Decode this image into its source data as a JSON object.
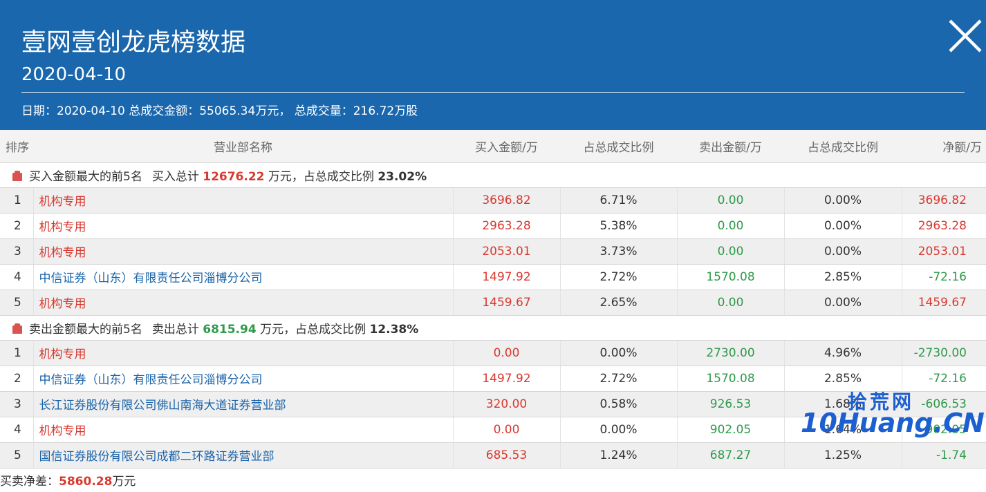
{
  "header": {
    "title": "壹网壹创龙虎榜数据",
    "date": "2020-04-10",
    "summary": "日期：2020-04-10 总成交金额：55065.34万元， 总成交量：216.72万股"
  },
  "table": {
    "columns": [
      "排序",
      "营业部名称",
      "买入金额/万",
      "占总成交比例",
      "卖出金额/万",
      "占总成交比例",
      "净额/万"
    ],
    "buy_group": {
      "label": "买入金额最大的前5名",
      "total_prefix": "买入总计",
      "total_value": "12676.22",
      "total_unit": "万元，",
      "ratio_prefix": "占总成交比例",
      "ratio_value": "23.02%"
    },
    "buy_rows": [
      {
        "rank": "1",
        "name": "机构专用",
        "buy": "3696.82",
        "buy_pct": "6.71%",
        "sell": "0.00",
        "sell_pct": "0.00%",
        "net": "3696.82"
      },
      {
        "rank": "2",
        "name": "机构专用",
        "buy": "2963.28",
        "buy_pct": "5.38%",
        "sell": "0.00",
        "sell_pct": "0.00%",
        "net": "2963.28"
      },
      {
        "rank": "3",
        "name": "机构专用",
        "buy": "2053.01",
        "buy_pct": "3.73%",
        "sell": "0.00",
        "sell_pct": "0.00%",
        "net": "2053.01"
      },
      {
        "rank": "4",
        "name": "中信证券（山东）有限责任公司淄博分公司",
        "buy": "1497.92",
        "buy_pct": "2.72%",
        "sell": "1570.08",
        "sell_pct": "2.85%",
        "net": "-72.16"
      },
      {
        "rank": "5",
        "name": "机构专用",
        "buy": "1459.67",
        "buy_pct": "2.65%",
        "sell": "0.00",
        "sell_pct": "0.00%",
        "net": "1459.67"
      }
    ],
    "sell_group": {
      "label": "卖出金额最大的前5名",
      "total_prefix": "卖出总计",
      "total_value": "6815.94",
      "total_unit": "万元，",
      "ratio_prefix": "占总成交比例",
      "ratio_value": "12.38%"
    },
    "sell_rows": [
      {
        "rank": "1",
        "name": "机构专用",
        "buy": "0.00",
        "buy_pct": "0.00%",
        "sell": "2730.00",
        "sell_pct": "4.96%",
        "net": "-2730.00"
      },
      {
        "rank": "2",
        "name": "中信证券（山东）有限责任公司淄博分公司",
        "buy": "1497.92",
        "buy_pct": "2.72%",
        "sell": "1570.08",
        "sell_pct": "2.85%",
        "net": "-72.16"
      },
      {
        "rank": "3",
        "name": "长江证券股份有限公司佛山南海大道证券营业部",
        "buy": "320.00",
        "buy_pct": "0.58%",
        "sell": "926.53",
        "sell_pct": "1.68%",
        "net": "-606.53"
      },
      {
        "rank": "4",
        "name": "机构专用",
        "buy": "0.00",
        "buy_pct": "0.00%",
        "sell": "902.05",
        "sell_pct": "1.64%",
        "net": "-902.05"
      },
      {
        "rank": "5",
        "name": "国信证券股份有限公司成都二环路证券营业部",
        "buy": "685.53",
        "buy_pct": "1.24%",
        "sell": "687.27",
        "sell_pct": "1.25%",
        "net": "-1.74"
      }
    ]
  },
  "footer": {
    "label": "买卖净差：",
    "value": "5860.28",
    "unit": "万元"
  },
  "watermark": {
    "cn": "拾荒网",
    "en": "10Huang.CN"
  },
  "colors": {
    "header_bg": "#1a67ad",
    "red": "#d9382f",
    "green": "#2e9a4a",
    "blue_link": "#1a63a8"
  },
  "icons": {
    "close": "close-icon",
    "group": "briefcase-icon"
  }
}
